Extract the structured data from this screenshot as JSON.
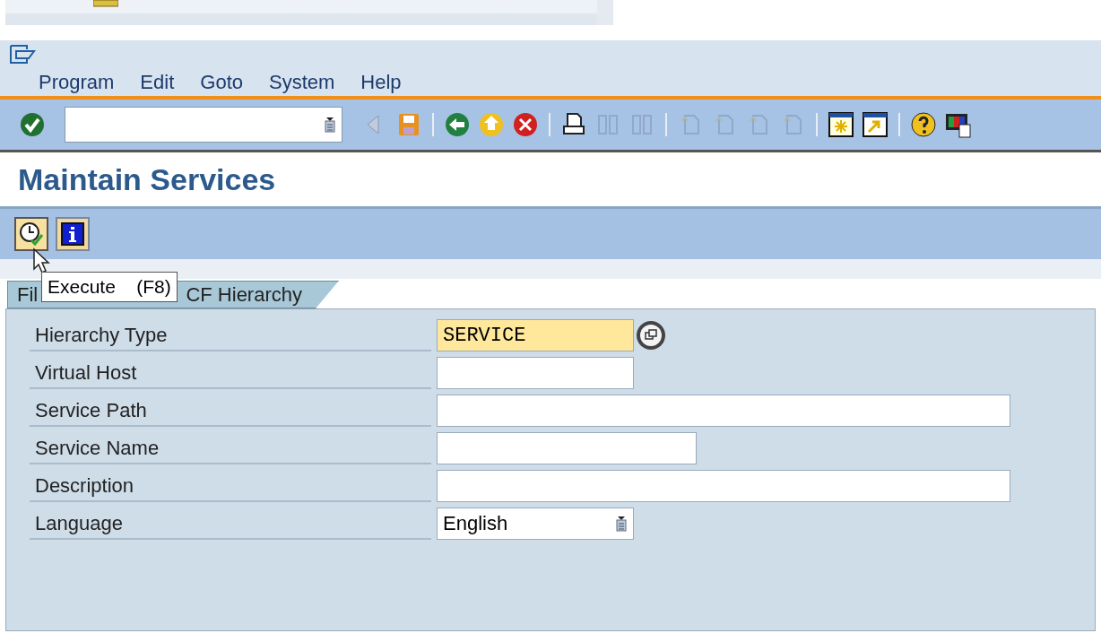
{
  "menu_bar": [
    {
      "label": "Program"
    },
    {
      "label": "Edit"
    },
    {
      "label": "Goto"
    },
    {
      "label": "System"
    },
    {
      "label": "Help"
    }
  ],
  "toolbar": [
    {
      "kind": "enter",
      "disabled": false
    },
    {
      "kind": "command"
    },
    {
      "kind": "back-arrow",
      "disabled": true
    },
    {
      "kind": "save",
      "disabled": false
    },
    {
      "kind": "sep"
    },
    {
      "kind": "back",
      "disabled": false
    },
    {
      "kind": "exit",
      "disabled": false
    },
    {
      "kind": "cancel",
      "disabled": false
    },
    {
      "kind": "sep"
    },
    {
      "kind": "print",
      "disabled": false
    },
    {
      "kind": "find",
      "disabled": true
    },
    {
      "kind": "find-next",
      "disabled": true
    },
    {
      "kind": "sep"
    },
    {
      "kind": "page",
      "disabled": true
    },
    {
      "kind": "page",
      "disabled": true
    },
    {
      "kind": "page",
      "disabled": true
    },
    {
      "kind": "page",
      "disabled": true
    },
    {
      "kind": "sep"
    },
    {
      "kind": "new-window",
      "disabled": false
    },
    {
      "kind": "shortcut",
      "disabled": false
    },
    {
      "kind": "sep"
    },
    {
      "kind": "help",
      "disabled": false
    },
    {
      "kind": "layout",
      "disabled": false
    }
  ],
  "title": "Maintain Services",
  "app_toolbar": [
    {
      "kind": "execute",
      "hovered": true
    },
    {
      "kind": "info",
      "hovered": false
    }
  ],
  "tooltip": {
    "text": "Execute    (F8)"
  },
  "tab": {
    "label_start": "Fil",
    "label_end": "CF Hierarchy"
  },
  "fields": [
    {
      "label": "Hierarchy Type",
      "value": "SERVICE",
      "kind": "required"
    },
    {
      "label": "Virtual Host",
      "kind": "text"
    },
    {
      "label": "Service Path",
      "kind": "text"
    },
    {
      "label": "Service Name",
      "kind": "text"
    },
    {
      "label": "Description",
      "kind": "text"
    },
    {
      "label": "Language",
      "value": "English",
      "kind": "dropdown"
    }
  ]
}
